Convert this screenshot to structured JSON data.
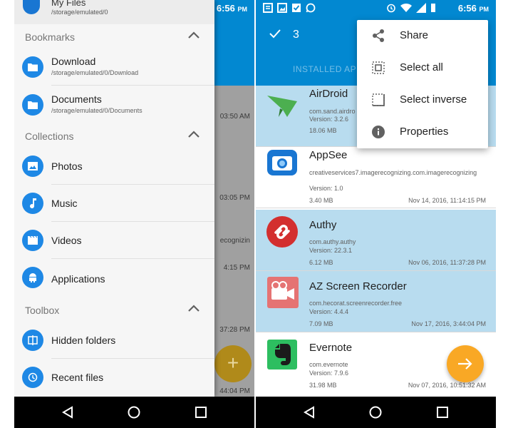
{
  "colors": {
    "primary": "#0288d1",
    "accent": "#f9a825",
    "icon_blue": "#1e88e5",
    "selected_row": "#b8dcef"
  },
  "left": {
    "status_time": "6:56",
    "status_ampm": "PM",
    "header": {
      "title": "My Files",
      "path": "/storage/emulated/0"
    },
    "bookmarks": {
      "label": "Bookmarks",
      "items": [
        {
          "label": "Download",
          "path": "/storage/emulated/0/Download",
          "icon": "folder-icon"
        },
        {
          "label": "Documents",
          "path": "/storage/emulated/0/Documents",
          "icon": "folder-icon"
        }
      ]
    },
    "collections": {
      "label": "Collections",
      "items": [
        {
          "label": "Photos",
          "icon": "image-icon"
        },
        {
          "label": "Music",
          "icon": "music-note-icon"
        },
        {
          "label": "Videos",
          "icon": "film-icon"
        },
        {
          "label": "Applications",
          "icon": "android-icon"
        }
      ]
    },
    "toolbox": {
      "label": "Toolbox",
      "items": [
        {
          "label": "Hidden folders",
          "icon": "hidden-folder-icon"
        },
        {
          "label": "Recent files",
          "icon": "history-icon"
        }
      ]
    },
    "background_times": [
      "03:50 AM",
      "03:05 PM",
      "ecognizin",
      "4:15 PM",
      "37:28 PM",
      "44:04 PM"
    ],
    "fab_symbol": "+"
  },
  "right": {
    "status_time": "6:56",
    "status_ampm": "PM",
    "selected_count": "3",
    "tab_label": "INSTALLED AP",
    "menu": [
      {
        "label": "Share",
        "icon": "share-icon"
      },
      {
        "label": "Select all",
        "icon": "select-all-icon"
      },
      {
        "label": "Select inverse",
        "icon": "select-inverse-icon"
      },
      {
        "label": "Properties",
        "icon": "info-icon"
      }
    ],
    "apps": [
      {
        "name": "AirDroid",
        "package": "com.sand.airdro",
        "version": "Version: 3.2.6",
        "size": "18.06 MB",
        "date": "",
        "selected": true
      },
      {
        "name": "AppSee",
        "package": "creativeservices7.imagerecognizing.com.imagerecognizing",
        "version": "Version: 1.0",
        "size": "3.40 MB",
        "date": "Nov 14, 2016, 11:14:15 PM",
        "selected": false
      },
      {
        "name": "Authy",
        "package": "com.authy.authy",
        "version": "Version: 22.3.1",
        "size": "6.12 MB",
        "date": "Nov 06, 2016, 11:37:28 PM",
        "selected": true
      },
      {
        "name": "AZ Screen Recorder",
        "package": "com.hecorat.screenrecorder.free",
        "version": "Version: 4.4.4",
        "size": "7.09 MB",
        "date": "Nov 17, 2016, 3:44:04 PM",
        "selected": true
      },
      {
        "name": "Evernote",
        "package": "com.evernote",
        "version": "Version: 7.9.6",
        "size": "31.98 MB",
        "date": "Nov 07, 2016, 10:51:32 AM",
        "selected": false
      }
    ]
  }
}
